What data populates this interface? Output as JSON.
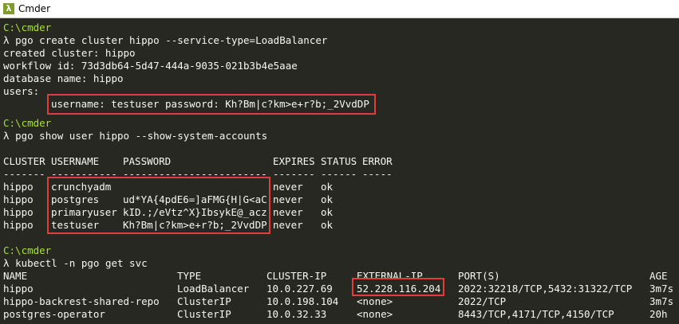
{
  "window": {
    "title": "Cmder",
    "icon": "lambda-icon",
    "icon_glyph": "λ",
    "accent_color": "#7f9d25"
  },
  "colors": {
    "background": "#272822",
    "text": "#f8f8f2",
    "prompt_path": "#a6e22e",
    "highlight_box": "#e63b3b"
  },
  "terminal": {
    "prompt_char": "λ",
    "block1": {
      "path": "C:\\cmder",
      "command": "pgo create cluster hippo --service-type=LoadBalancer",
      "output": [
        "created cluster: hippo",
        "workflow id: 73d3db64-5d47-444a-9035-021b3b4e5aae",
        "database name: hippo",
        "users:"
      ],
      "user_line": "username: testuser password: Kh?Bm|c?km>e+r?b;_2VvdDP"
    },
    "block2": {
      "path": "C:\\cmder",
      "command": "pgo show user hippo --show-system-accounts",
      "headers": {
        "cluster": "CLUSTER",
        "username": "USERNAME",
        "password": "PASSWORD",
        "expires": "EXPIRES",
        "status": "STATUS",
        "error": "ERROR"
      },
      "separators": {
        "cluster": "-------",
        "username": "-----------",
        "password": "------------------------",
        "expires": "-------",
        "status": "------",
        "error": "-----"
      },
      "rows": [
        {
          "cluster": "hippo",
          "username": "crunchyadm",
          "password": "",
          "expires": "never",
          "status": "ok",
          "error": ""
        },
        {
          "cluster": "hippo",
          "username": "postgres",
          "password": "ud*YA{4pdE6=]aFMG{H|G<aC",
          "expires": "never",
          "status": "ok",
          "error": ""
        },
        {
          "cluster": "hippo",
          "username": "primaryuser",
          "password": "kID.;/eVtz^X}IbsykE@_acz",
          "expires": "never",
          "status": "ok",
          "error": ""
        },
        {
          "cluster": "hippo",
          "username": "testuser",
          "password": "Kh?Bm|c?km>e+r?b;_2VvdDP",
          "expires": "never",
          "status": "ok",
          "error": ""
        }
      ]
    },
    "block3": {
      "path": "C:\\cmder",
      "command": "kubectl -n pgo get svc",
      "headers": {
        "name": "NAME",
        "type": "TYPE",
        "cluster_ip": "CLUSTER-IP",
        "external_ip": "EXTERNAL-IP",
        "ports": "PORT(S)",
        "age": "AGE"
      },
      "rows": [
        {
          "name": "hippo",
          "type": "LoadBalancer",
          "cluster_ip": "10.0.227.69",
          "external_ip": "52.228.116.204",
          "ports": "2022:32218/TCP,5432:31322/TCP",
          "age": "3m7s"
        },
        {
          "name": "hippo-backrest-shared-repo",
          "type": "ClusterIP",
          "cluster_ip": "10.0.198.104",
          "external_ip": "<none>",
          "ports": "2022/TCP",
          "age": "3m7s"
        },
        {
          "name": "postgres-operator",
          "type": "ClusterIP",
          "cluster_ip": "10.0.32.33",
          "external_ip": "<none>",
          "ports": "8443/TCP,4171/TCP,4150/TCP",
          "age": "20h"
        }
      ]
    }
  }
}
